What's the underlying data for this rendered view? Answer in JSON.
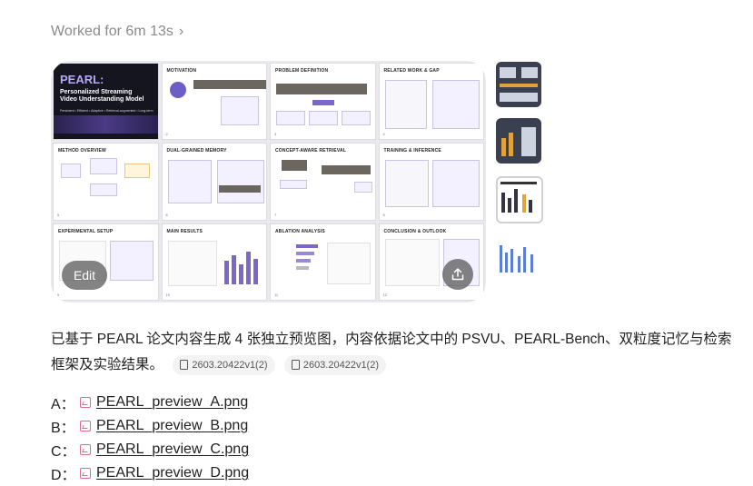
{
  "status": {
    "worked_label": "Worked for 6m 13s"
  },
  "preview": {
    "edit_label": "Edit",
    "slides": [
      {
        "title": "PEARL:",
        "subtitle": "Personalized Streaming Video Understanding Model",
        "tagline": "Persistent • Efficient • Adaptive • Retrieval-augmented • Long-term"
      },
      {
        "title": "MOTIVATION"
      },
      {
        "title": "PROBLEM DEFINITION"
      },
      {
        "title": "RELATED WORK & GAP"
      },
      {
        "title": "METHOD OVERVIEW"
      },
      {
        "title": "DUAL-GRAINED MEMORY"
      },
      {
        "title": "CONCEPT-AWARE RETRIEVAL"
      },
      {
        "title": "TRAINING & INFERENCE"
      },
      {
        "title": "EXPERIMENTAL SETUP"
      },
      {
        "title": "MAIN RESULTS"
      },
      {
        "title": "ABLATION ANALYSIS"
      },
      {
        "title": "CONCLUSION & OUTLOOK"
      }
    ]
  },
  "message": {
    "text": "已基于 PEARL 论文内容生成 4 张独立预览图，内容依据论文中的 PSVU、PEARL-Bench、双粒度记忆与检索框架及实验结果。",
    "citations": [
      "2603.20422v1(2)",
      "2603.20422v1(2)"
    ]
  },
  "files": [
    {
      "label": "A：",
      "name": "PEARL_preview_A.png"
    },
    {
      "label": "B：",
      "name": "PEARL_preview_B.png"
    },
    {
      "label": "C：",
      "name": "PEARL_preview_C.png"
    },
    {
      "label": "D：",
      "name": "PEARL_preview_D.png"
    }
  ],
  "icons": {
    "worked_chevron": "chevron-right-icon",
    "share": "share-upload-icon",
    "citation": "document-icon",
    "file": "image-file-icon"
  },
  "colors": {
    "accent": "#7b67c9",
    "file_icon": "#e36a8a"
  }
}
